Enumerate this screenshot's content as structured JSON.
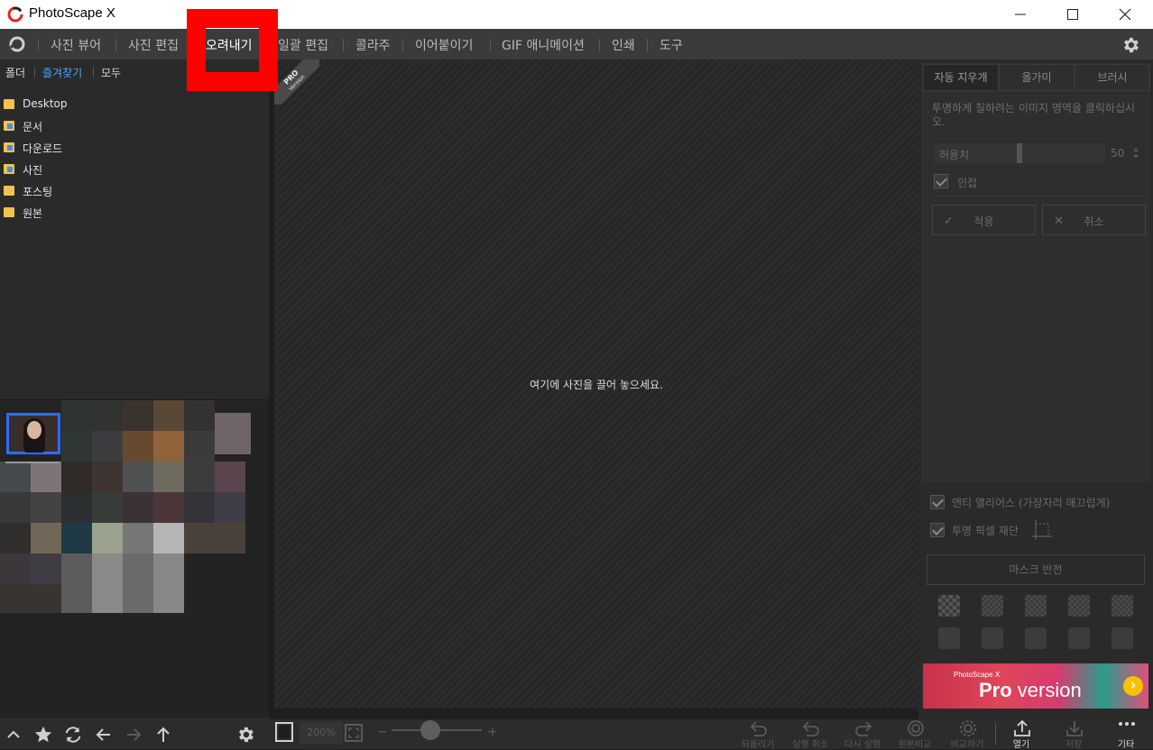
{
  "window": {
    "title": "PhotoScape X",
    "minimize_icon": "minimize-icon",
    "maximize_icon": "maximize-icon",
    "close_icon": "close-icon"
  },
  "menu": {
    "items": [
      {
        "label": "사진 뷰어"
      },
      {
        "label": "사진 편집"
      },
      {
        "label": "오려내기",
        "active": true
      },
      {
        "label": "일괄 편집"
      },
      {
        "label": "콜라주"
      },
      {
        "label": "이어붙이기"
      },
      {
        "label": "GIF 애니메이션"
      },
      {
        "label": "인쇄"
      },
      {
        "label": "도구"
      }
    ]
  },
  "left_panel": {
    "tabs": [
      {
        "label": "폴더"
      },
      {
        "label": "즐겨찾기",
        "active": true
      },
      {
        "label": "모두"
      }
    ],
    "tree": [
      {
        "label": "Desktop"
      },
      {
        "label": "문서"
      },
      {
        "label": "다운로드"
      },
      {
        "label": "사진"
      },
      {
        "label": "포스팅"
      },
      {
        "label": "원본"
      }
    ]
  },
  "canvas": {
    "drop_hint": "여기에 사진을 끌어 놓으세요.",
    "ribbon_pro": "PRO",
    "ribbon_version": "Version"
  },
  "right_panel": {
    "tabs": [
      {
        "label": "자동 지우개",
        "active": true
      },
      {
        "label": "올가미"
      },
      {
        "label": "브러시"
      }
    ],
    "description": "투명하게 칠하려는 이미지 영역을 클릭하십시오.",
    "tolerance_label": "허용치",
    "tolerance_value": "50",
    "adjacent_label": "인접",
    "apply_label": "적용",
    "cancel_label": "취소",
    "antialias_label": "앤티 앨리어스 (가장자리 매끄럽게)",
    "crop_transparent_label": "투명 픽셀 재단",
    "invert_mask_label": "마스크 반전"
  },
  "promo": {
    "brand": "PhotoScape X",
    "pro": "Pro",
    "version": " version"
  },
  "bottom_bar": {
    "zoom_value": "200%",
    "zoom_minus": "−",
    "zoom_plus": "+",
    "actions": [
      {
        "label": "되돌리기"
      },
      {
        "label": "실행 취소"
      },
      {
        "label": "다시 실행"
      },
      {
        "label": "원본비교"
      },
      {
        "label": "비교하기"
      },
      {
        "label": "열기",
        "active": true
      },
      {
        "label": "저장"
      },
      {
        "label": "기타",
        "active": true
      }
    ]
  },
  "colors": {
    "accent_blue": "#4aa7ff",
    "highlight_red": "#ff0000",
    "selection_blue": "#2f6bff"
  }
}
